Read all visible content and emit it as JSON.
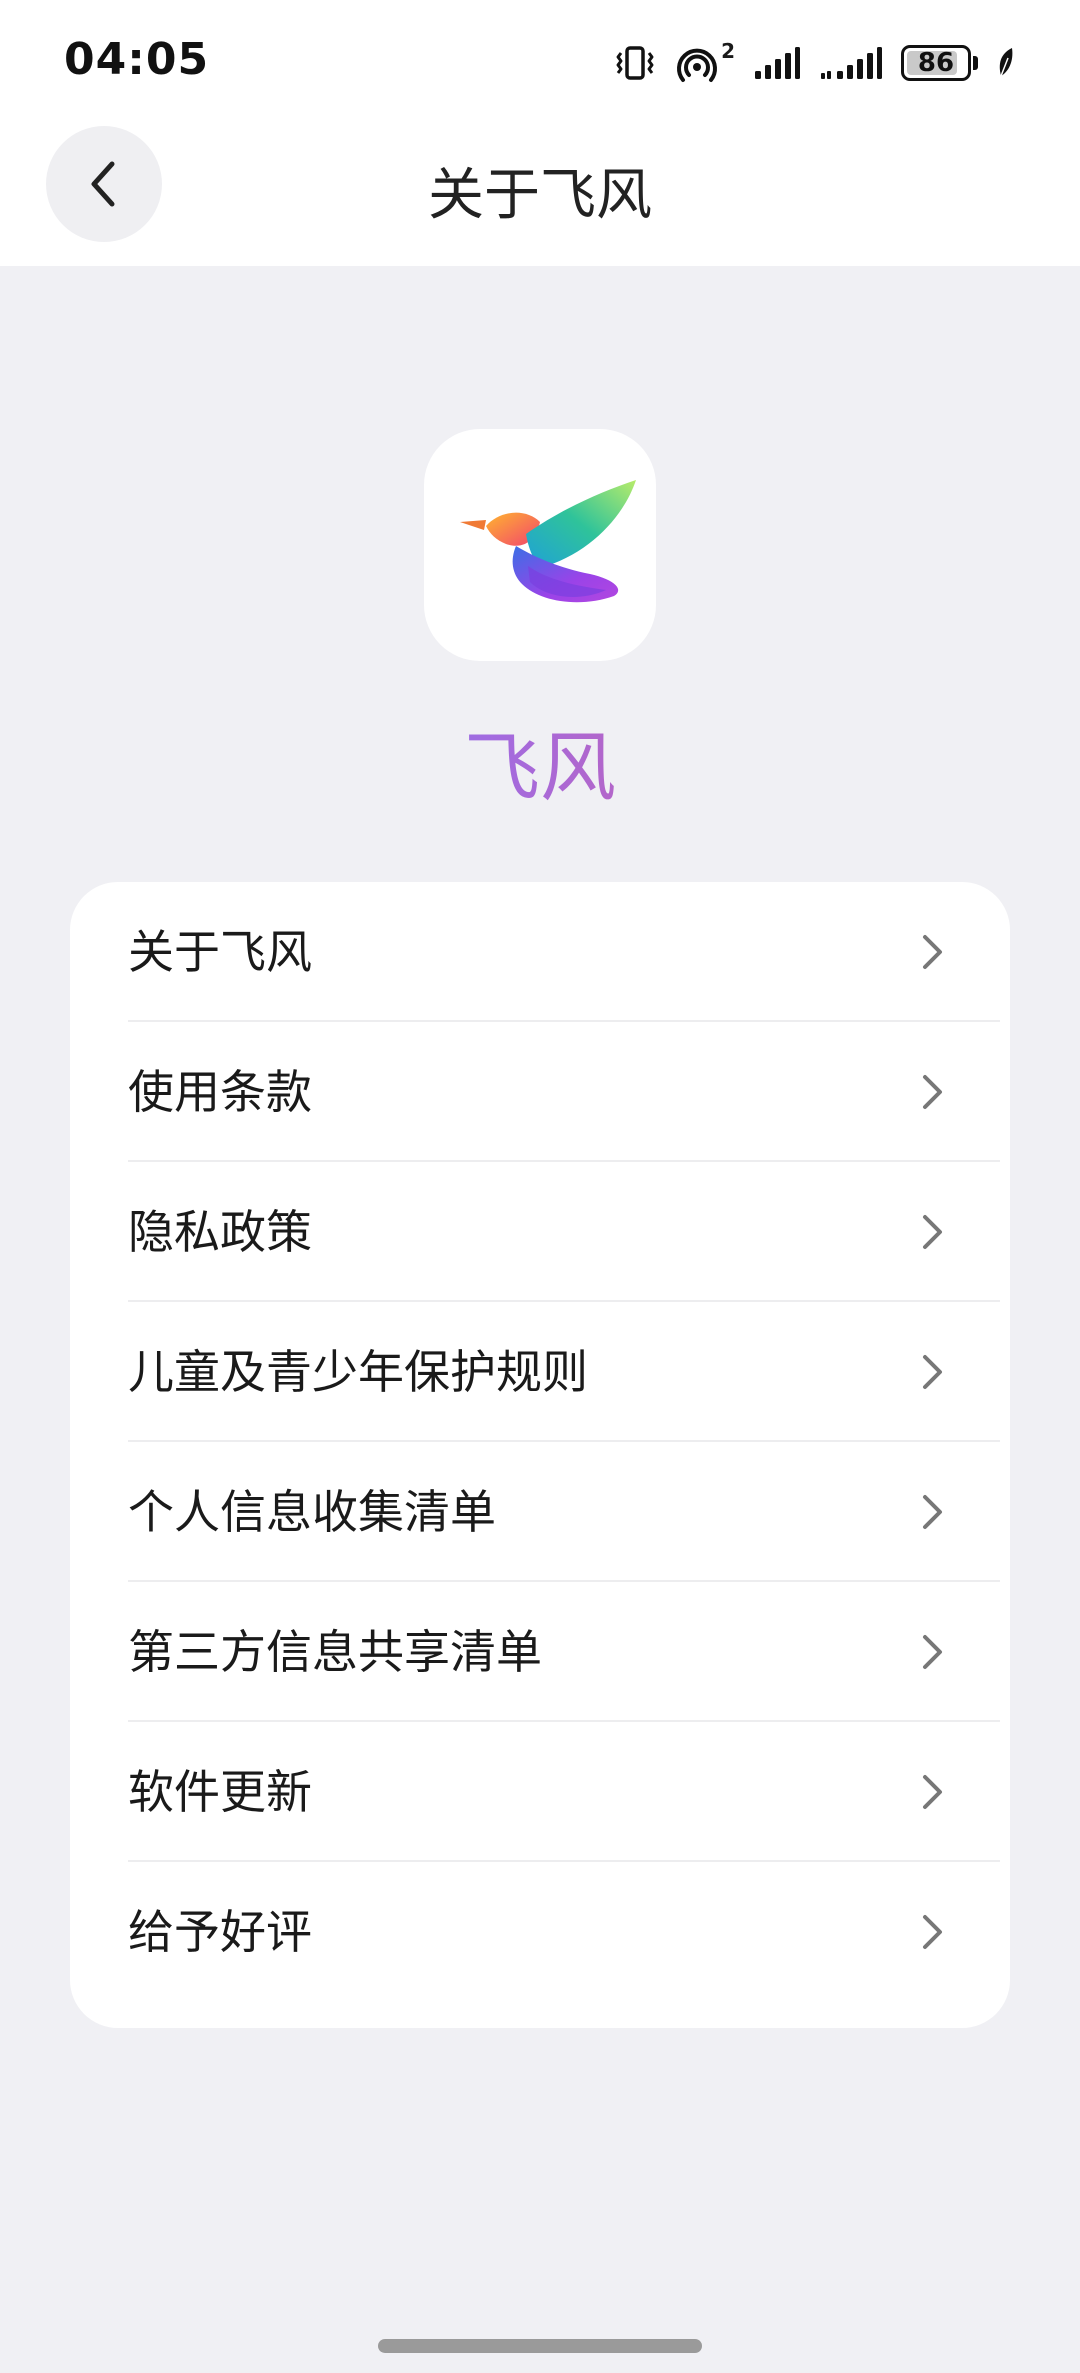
{
  "status_bar": {
    "time": "04:05",
    "battery_level": "86",
    "battery_fraction": 0.86,
    "icons": [
      "vibrate-icon",
      "hotspot-icon",
      "signal-icon",
      "signal-icon",
      "battery-icon",
      "leaf-icon"
    ],
    "hotspot_badge": "2"
  },
  "header": {
    "title": "关于飞风",
    "back_icon": "chevron-left-icon"
  },
  "app": {
    "name": "飞风",
    "logo_icon": "bird-logo-icon"
  },
  "menu": {
    "items": [
      {
        "label": "关于飞风"
      },
      {
        "label": "使用条款"
      },
      {
        "label": "隐私政策"
      },
      {
        "label": "儿童及青少年保护规则"
      },
      {
        "label": "个人信息收集清单"
      },
      {
        "label": "第三方信息共享清单"
      },
      {
        "label": "软件更新"
      },
      {
        "label": "给予好评"
      }
    ],
    "chevron_icon": "chevron-right-icon"
  },
  "colors": {
    "background": "#f0f0f4",
    "card": "#ffffff",
    "app_name_gradient": [
      "#3d8ef5",
      "#a26be0",
      "#f0547a"
    ]
  }
}
